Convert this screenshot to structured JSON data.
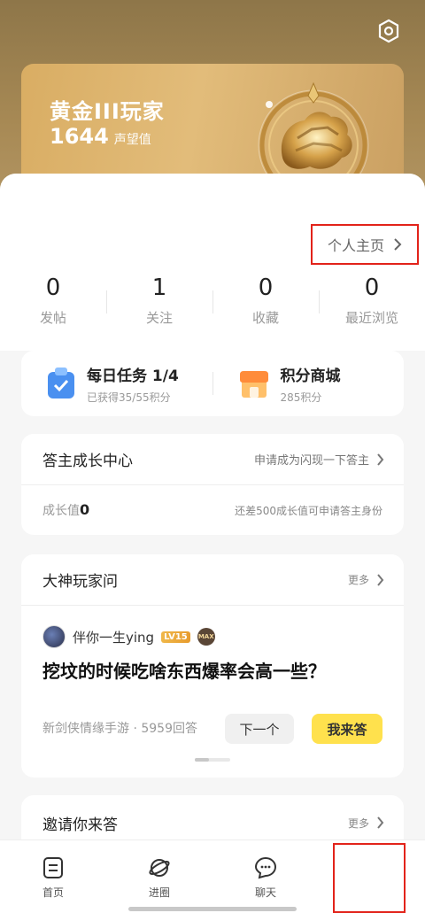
{
  "header": {
    "rank_title": "黄金III玩家",
    "score": "1644",
    "score_unit": "声望值"
  },
  "profile_link": "个人主页",
  "stats": [
    {
      "value": "0",
      "label": "发帖"
    },
    {
      "value": "1",
      "label": "关注"
    },
    {
      "value": "0",
      "label": "收藏"
    },
    {
      "value": "0",
      "label": "最近浏览"
    }
  ],
  "quick": {
    "task_title": "每日任务 1/4",
    "task_sub": "已获得35/55积分",
    "shop_title": "积分商城",
    "shop_sub": "285积分"
  },
  "growth": {
    "title": "答主成长中心",
    "apply": "申请成为闪现一下答主",
    "label": "成长值",
    "value": "0",
    "hint": "还差500成长值可申请答主身份"
  },
  "qa": {
    "title": "大神玩家问",
    "more": "更多",
    "username": "伴你一生ying",
    "level": "LV15",
    "max": "MAX",
    "question": "挖坟的时候吃啥东西爆率会高一些？",
    "meta": "新剑侠情缘手游 · 5959回答",
    "next": "下一个",
    "answer": "我来答"
  },
  "invite": {
    "title": "邀请你来答",
    "more": "更多"
  },
  "tabs": [
    {
      "label": "首页"
    },
    {
      "label": "进圈"
    },
    {
      "label": "聊天"
    },
    {
      "label": ""
    }
  ],
  "colors": {
    "gold": "#d9ad63",
    "highlight": "#e2231a",
    "answer_button": "#ffe14d"
  }
}
